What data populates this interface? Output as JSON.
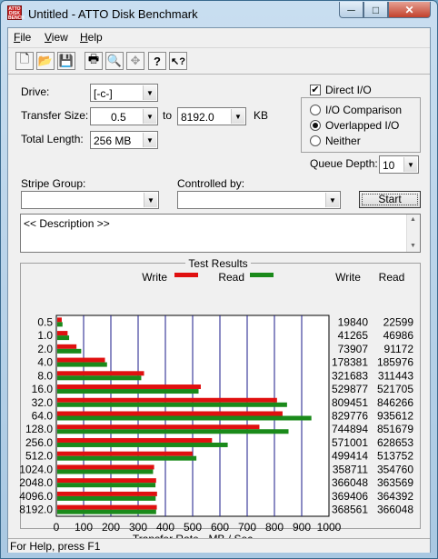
{
  "window": {
    "title": "Untitled - ATTO Disk Benchmark",
    "icon_text": "ATTO DISK BENCH",
    "min_glyph": "─",
    "max_glyph": "□",
    "close_glyph": "✕"
  },
  "menu": [
    {
      "key": "F",
      "rest": "ile"
    },
    {
      "key": "V",
      "rest": "iew"
    },
    {
      "key": "H",
      "rest": "elp"
    }
  ],
  "toolbar": [
    {
      "name": "new-icon",
      "glyph": "🗋"
    },
    {
      "name": "open-icon",
      "glyph": "📂"
    },
    {
      "name": "save-icon",
      "glyph": "💾"
    },
    {
      "name": "print-icon",
      "glyph": "🖶"
    },
    {
      "name": "print-preview-icon",
      "glyph": "🔍"
    },
    {
      "name": "move-icon",
      "glyph": "✥"
    },
    {
      "name": "help-icon",
      "glyph": "?"
    },
    {
      "name": "context-help-icon",
      "glyph": "↖?"
    }
  ],
  "settings": {
    "drive_label": "Drive:",
    "drive_value": "[-c-]",
    "transfer_size_label": "Transfer Size:",
    "transfer_from": "0.5",
    "to_label": "to",
    "transfer_to": "8192.0",
    "kb_label": "KB",
    "total_length_label": "Total Length:",
    "total_length_value": "256 MB",
    "direct_io_label": "Direct I/O",
    "direct_io_checked": true,
    "io_comparison_label": "I/O Comparison",
    "overlapped_io_label": "Overlapped I/O",
    "neither_label": "Neither",
    "queue_depth_label": "Queue Depth:",
    "queue_depth_value": "10",
    "stripe_group_label": "Stripe Group:",
    "controlled_by_label": "Controlled by:",
    "start_label": "Start",
    "description_text": "<< Description >>"
  },
  "results": {
    "title": "Test Results",
    "legend_write": "Write",
    "legend_read": "Read",
    "col_write": "Write",
    "col_read": "Read",
    "write_color": "#e01010",
    "read_color": "#1a8a1a"
  },
  "chart_data": {
    "type": "bar",
    "title": "Test Results",
    "xlabel": "Transfer Rate - MB / Sec",
    "ylabel": "",
    "xlim": [
      0,
      1000
    ],
    "x_ticks": [
      0,
      100,
      200,
      300,
      400,
      500,
      600,
      700,
      800,
      900,
      1000
    ],
    "categories": [
      "0.5",
      "1.0",
      "2.0",
      "4.0",
      "8.0",
      "16.0",
      "32.0",
      "64.0",
      "128.0",
      "256.0",
      "512.0",
      "1024.0",
      "2048.0",
      "4096.0",
      "8192.0"
    ],
    "series": [
      {
        "name": "Write",
        "values": [
          19840,
          41265,
          73907,
          178381,
          321683,
          529877,
          809451,
          829776,
          744894,
          571001,
          499414,
          358711,
          366048,
          369406,
          368561
        ]
      },
      {
        "name": "Read",
        "values": [
          22599,
          46986,
          91172,
          185976,
          311443,
          521705,
          846266,
          935612,
          851679,
          628653,
          513752,
          354760,
          363569,
          364392,
          366048
        ]
      }
    ],
    "grid": true,
    "legend": "top"
  },
  "status": {
    "text": "For Help, press F1"
  }
}
